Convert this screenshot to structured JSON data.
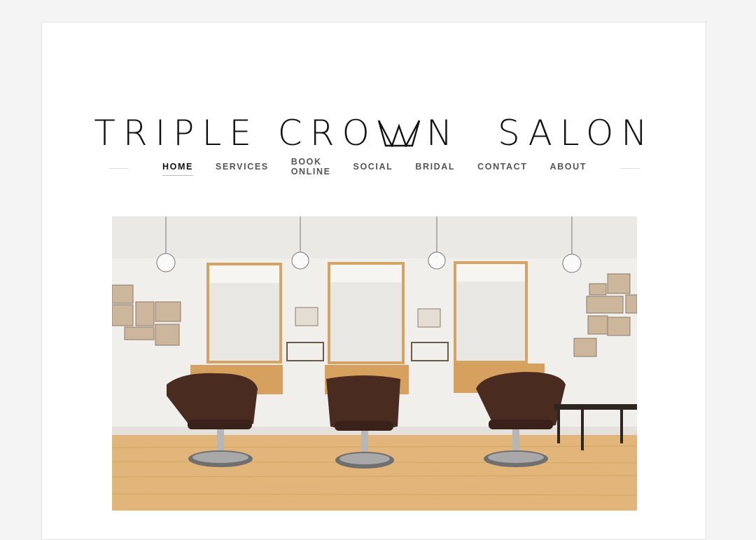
{
  "site": {
    "title_part1": "TRIPLE CRO",
    "title_part2": "N  SALON"
  },
  "nav": {
    "items": [
      {
        "label": "HOME",
        "active": true
      },
      {
        "label": "SERVICES",
        "active": false
      },
      {
        "label": "BOOK ONLINE",
        "active": false
      },
      {
        "label": "SOCIAL",
        "active": false
      },
      {
        "label": "BRIDAL",
        "active": false
      },
      {
        "label": "CONTACT",
        "active": false
      },
      {
        "label": "ABOUT",
        "active": false
      }
    ]
  },
  "colors": {
    "page_background": "#ffffff",
    "outer_background": "#f4f4f4",
    "text": "#111111",
    "nav_text": "#555555"
  },
  "hero": {
    "icon": "salon-interior-photo"
  }
}
